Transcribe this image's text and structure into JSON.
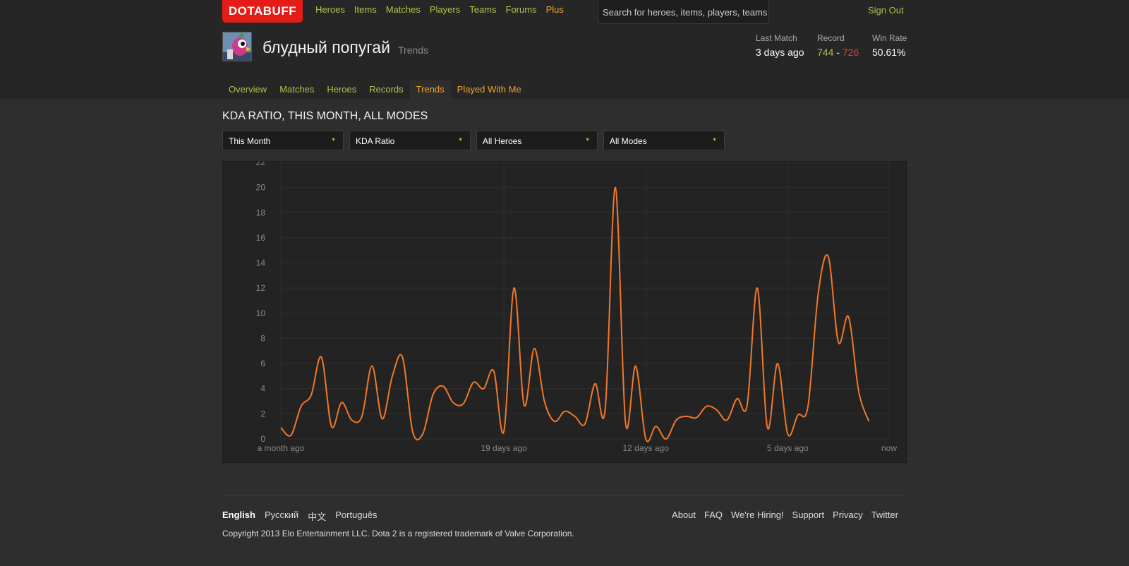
{
  "topbar": {
    "logo": "DOTABUFF",
    "nav": [
      "Heroes",
      "Items",
      "Matches",
      "Players",
      "Teams",
      "Forums",
      "Plus"
    ],
    "search_placeholder": "Search for heroes, items, players, teams",
    "signout": "Sign Out"
  },
  "player": {
    "name": "блудный попугай",
    "section": "Trends",
    "stats": {
      "last_match_label": "Last Match",
      "last_match": "3 days ago",
      "record_label": "Record",
      "wins": "744",
      "sep": "-",
      "losses": "726",
      "winrate_label": "Win Rate",
      "winrate": "50.61%"
    }
  },
  "tabs": [
    "Overview",
    "Matches",
    "Heroes",
    "Records",
    "Trends",
    "Played With Me"
  ],
  "active_tab": "Trends",
  "page": {
    "heading": "KDA RATIO, THIS MONTH, ALL MODES",
    "filters": [
      "This Month",
      "KDA Ratio",
      "All Heroes",
      "All Modes"
    ]
  },
  "colors": {
    "accent_green": "#a8c64e",
    "accent_orange": "#f0a030",
    "line": "#f07828",
    "logo_red": "#e41b17",
    "loss_red": "#d9433a"
  },
  "chart_data": {
    "type": "line",
    "ylim": [
      0,
      22
    ],
    "yticks": [
      0,
      2,
      4,
      6,
      8,
      10,
      12,
      14,
      16,
      18,
      20,
      22
    ],
    "xlim_days_ago": [
      30,
      0
    ],
    "xticks": [
      {
        "days_ago": 30,
        "label": "a month ago"
      },
      {
        "days_ago": 19,
        "label": "19 days ago"
      },
      {
        "days_ago": 12,
        "label": "12 days ago"
      },
      {
        "days_ago": 5,
        "label": "5 days ago"
      },
      {
        "days_ago": 0,
        "label": "now"
      }
    ],
    "grid": true,
    "series": [
      {
        "points": [
          [
            30.0,
            0.9
          ],
          [
            29.5,
            0.3
          ],
          [
            29.0,
            2.6
          ],
          [
            28.5,
            3.5
          ],
          [
            28.0,
            6.5
          ],
          [
            27.5,
            1.0
          ],
          [
            27.0,
            2.9
          ],
          [
            26.5,
            1.5
          ],
          [
            26.0,
            1.8
          ],
          [
            25.5,
            5.8
          ],
          [
            25.0,
            1.6
          ],
          [
            24.5,
            5.0
          ],
          [
            24.0,
            6.5
          ],
          [
            23.5,
            0.6
          ],
          [
            23.0,
            0.4
          ],
          [
            22.5,
            3.5
          ],
          [
            22.0,
            4.2
          ],
          [
            21.5,
            2.9
          ],
          [
            21.0,
            2.8
          ],
          [
            20.5,
            4.5
          ],
          [
            20.0,
            4.0
          ],
          [
            19.5,
            5.4
          ],
          [
            19.0,
            0.6
          ],
          [
            18.5,
            12.0
          ],
          [
            18.0,
            2.7
          ],
          [
            17.5,
            7.2
          ],
          [
            17.0,
            3.0
          ],
          [
            16.5,
            1.4
          ],
          [
            16.0,
            2.2
          ],
          [
            15.5,
            1.8
          ],
          [
            15.0,
            1.2
          ],
          [
            14.5,
            4.4
          ],
          [
            14.0,
            2.4
          ],
          [
            13.5,
            20.0
          ],
          [
            13.0,
            1.3
          ],
          [
            12.5,
            5.8
          ],
          [
            12.0,
            0.0
          ],
          [
            11.5,
            1.0
          ],
          [
            11.0,
            0.0
          ],
          [
            10.5,
            1.5
          ],
          [
            10.0,
            1.8
          ],
          [
            9.5,
            1.7
          ],
          [
            9.0,
            2.6
          ],
          [
            8.5,
            2.3
          ],
          [
            8.0,
            1.5
          ],
          [
            7.5,
            3.2
          ],
          [
            7.0,
            2.7
          ],
          [
            6.5,
            12.0
          ],
          [
            6.0,
            0.9
          ],
          [
            5.5,
            6.0
          ],
          [
            5.0,
            0.4
          ],
          [
            4.5,
            1.9
          ],
          [
            4.0,
            2.6
          ],
          [
            3.5,
            11.5
          ],
          [
            3.0,
            14.5
          ],
          [
            2.5,
            7.7
          ],
          [
            2.0,
            9.7
          ],
          [
            1.5,
            3.8
          ],
          [
            1.0,
            1.4
          ]
        ]
      }
    ]
  },
  "footer": {
    "langs": [
      "English",
      "Русский",
      "中文",
      "Português"
    ],
    "current_lang": "English",
    "links": [
      "About",
      "FAQ",
      "We're Hiring!",
      "Support",
      "Privacy",
      "Twitter"
    ],
    "copyright": "Copyright 2013 Elo Entertainment LLC. Dota 2 is a registered trademark of Valve Corporation."
  }
}
